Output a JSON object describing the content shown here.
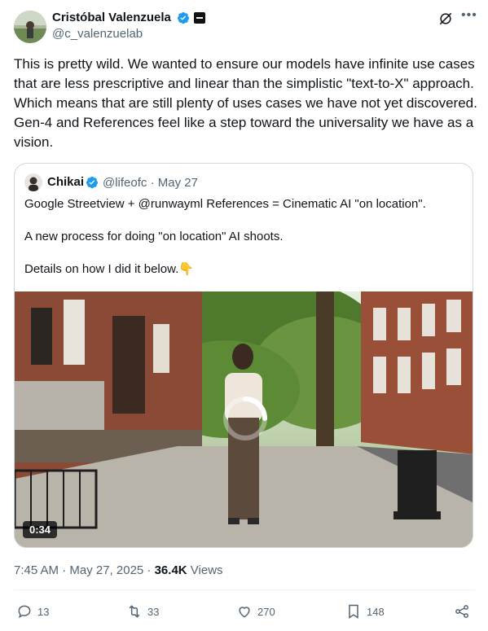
{
  "author": {
    "name": "Cristóbal Valenzuela",
    "handle": "@c_valenzuelab"
  },
  "post": {
    "text": "This is pretty wild. We wanted to ensure our models have infinite use cases that are less prescriptive and linear than the simplistic \"text-to-X\" approach. Which means that are still plenty of uses cases we have not yet discovered. Gen-4 and References feel like a step toward the universality we have as a vision."
  },
  "quote": {
    "name": "Chikai",
    "meta": "@lifeofc · May 27",
    "line1": "Google Streetview + @runwayml References = Cinematic AI \"on location\".",
    "line2": "A new process for doing \"on location\" AI shoots.",
    "line3": "Details on how I did it below.👇",
    "video_duration": "0:34"
  },
  "timestamp": {
    "date": "7:45 AM · May 27, 2025 · ",
    "views_count": "36.4K",
    "views_label": " Views"
  },
  "actions": {
    "replies": "13",
    "reposts": "33",
    "likes": "270",
    "bookmarks": "148"
  },
  "colors": {
    "verified": "#1d9bf0",
    "muted": "#536471",
    "text": "#0f1419"
  }
}
